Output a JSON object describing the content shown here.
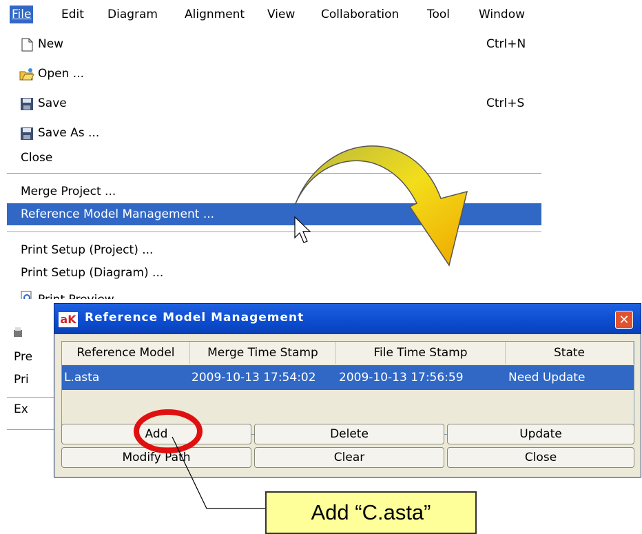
{
  "menubar": [
    {
      "label": "File"
    },
    {
      "label": "Edit"
    },
    {
      "label": "Diagram"
    },
    {
      "label": "Alignment"
    },
    {
      "label": "View"
    },
    {
      "label": "Collaboration"
    },
    {
      "label": "Tool"
    },
    {
      "label": "Window"
    }
  ],
  "file_menu": {
    "new": {
      "label": "New",
      "shortcut": "Ctrl+N"
    },
    "open": {
      "label": "Open ..."
    },
    "save": {
      "label": "Save",
      "shortcut": "Ctrl+S"
    },
    "save_as": {
      "label": "Save As ..."
    },
    "close": {
      "label": "Close"
    },
    "merge_project": {
      "label": "Merge Project ..."
    },
    "reference_model_management": {
      "label": "Reference Model Management ..."
    },
    "print_setup_project": {
      "label": "Print Setup (Project) ..."
    },
    "print_setup_diagram": {
      "label": "Print Setup (Diagram) ..."
    },
    "print_preview": {
      "label": "Print Preview"
    },
    "partial": [
      "Pre",
      "Pri",
      "Ex"
    ]
  },
  "dialog": {
    "title": "Reference Model Management",
    "title_icon": "aK",
    "columns": [
      "Reference Model",
      "Merge Time Stamp",
      "File Time Stamp",
      "State"
    ],
    "rows": [
      {
        "reference_model": "L.asta",
        "merge_time_stamp": "2009-10-13 17:54:02",
        "file_time_stamp": "2009-10-13 17:56:59",
        "state": "Need Update"
      }
    ],
    "buttons": {
      "add": "Add",
      "delete": "Delete",
      "update": "Update",
      "modify_path": "Modify Path",
      "clear": "Clear",
      "close": "Close"
    }
  },
  "annotation": {
    "callout": "Add “C.asta”"
  },
  "colors": {
    "highlight": "#3168c5",
    "arrow": "#e8d21a",
    "circle": "#e01010",
    "callout_bg": "#ffff99"
  }
}
